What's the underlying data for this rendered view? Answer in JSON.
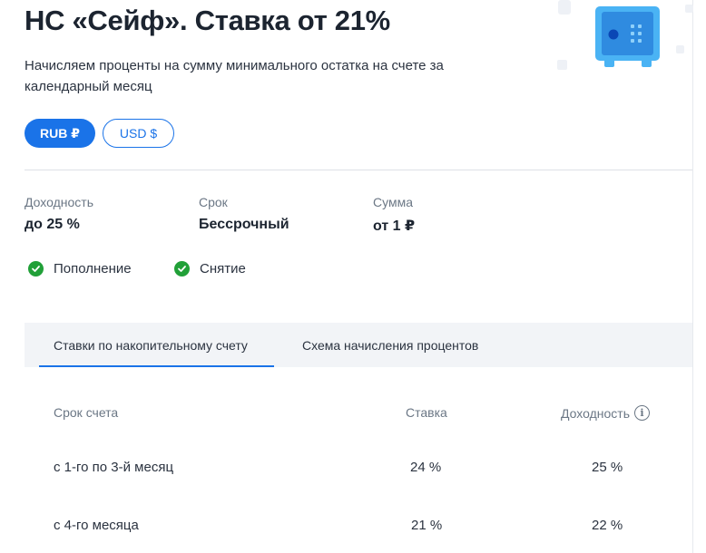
{
  "header": {
    "title": "НС «Сейф». Ставка от 21%",
    "subtitle": "Начисляем проценты на сумму минимального остатка на счете за календарный месяц"
  },
  "currencies": [
    {
      "label": "RUB ₽",
      "selected": true
    },
    {
      "label": "USD $",
      "selected": false
    }
  ],
  "stats": [
    {
      "label": "Доходность",
      "value": "до 25 %"
    },
    {
      "label": "Срок",
      "value": "Бессрочный"
    },
    {
      "label": "Сумма",
      "value": "от 1 ₽"
    }
  ],
  "features": [
    {
      "label": "Пополнение",
      "icon": "check-icon"
    },
    {
      "label": "Снятие",
      "icon": "check-icon"
    }
  ],
  "tabs": [
    {
      "label": "Ставки по накопительному счету",
      "active": true
    },
    {
      "label": "Схема начисления процентов",
      "active": false
    }
  ],
  "table": {
    "headers": [
      "Срок счета",
      "Ставка",
      "Доходность"
    ],
    "info_icon": "info-icon",
    "rows": [
      {
        "term": "с 1-го по 3-й месяц",
        "rate": "24 %",
        "yield": "25 %"
      },
      {
        "term": "с 4-го месяца",
        "rate": "21 %",
        "yield": "22 %"
      }
    ]
  },
  "colors": {
    "accent": "#1a73e8",
    "success": "#21a038",
    "text": "#1c2430",
    "muted": "#6b7785",
    "tabs_background": "#f2f4f7"
  }
}
